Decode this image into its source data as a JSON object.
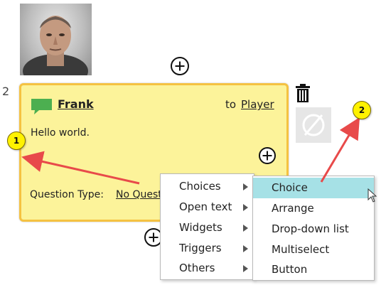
{
  "node": {
    "index": "2",
    "speaker": "Frank",
    "to_label": "to",
    "to_target": "Player",
    "message": "Hello world.",
    "question_type_label": "Question Type:",
    "question_type_value": "No Question"
  },
  "context_menu": {
    "items": [
      {
        "label": "Choices",
        "has_submenu": true
      },
      {
        "label": "Open text",
        "has_submenu": true
      },
      {
        "label": "Widgets",
        "has_submenu": true
      },
      {
        "label": "Triggers",
        "has_submenu": true
      },
      {
        "label": "Others",
        "has_submenu": true
      }
    ]
  },
  "submenu": {
    "items": [
      {
        "label": "Choice",
        "highlighted": true
      },
      {
        "label": "Arrange"
      },
      {
        "label": "Drop-down list"
      },
      {
        "label": "Multiselect"
      },
      {
        "label": "Button"
      }
    ]
  },
  "callouts": [
    "1",
    "2"
  ],
  "colors": {
    "card_background": "#fcf39a",
    "card_border": "#f5c242",
    "speech_icon": "#4caf50",
    "highlight": "#a6e1e6",
    "callout": "#fff200",
    "annotation_arrow": "#e84a4a"
  },
  "icons": [
    "speech-bubble-icon",
    "trash-icon",
    "null-symbol-icon",
    "add-circle-icon",
    "submenu-arrow-icon",
    "mouse-cursor-icon"
  ]
}
